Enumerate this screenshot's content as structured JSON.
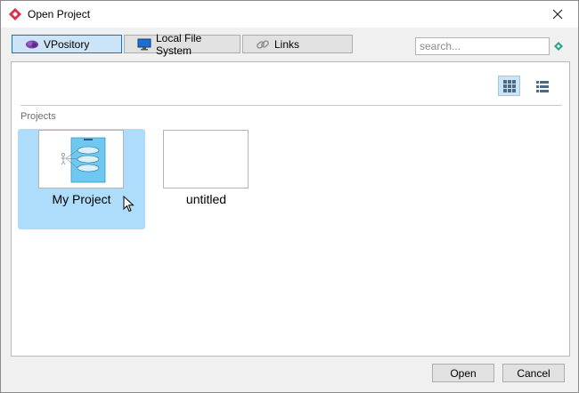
{
  "window": {
    "title": "Open Project"
  },
  "tabs": [
    {
      "label": "VPository",
      "icon": "vpository-icon",
      "active": true
    },
    {
      "label": "Local File System",
      "icon": "monitor-icon",
      "active": false
    },
    {
      "label": "Links",
      "icon": "link-icon",
      "active": false
    }
  ],
  "search": {
    "placeholder": "search...",
    "value": ""
  },
  "view": {
    "modes": [
      "grid-view-icon",
      "list-view-icon"
    ],
    "active": "grid-view-icon"
  },
  "section": {
    "label": "Projects"
  },
  "projects": [
    {
      "name": "My Project",
      "selected": true
    },
    {
      "name": "untitled",
      "selected": false
    }
  ],
  "buttons": {
    "open": "Open",
    "cancel": "Cancel"
  },
  "colors": {
    "selection": "#aedcfb",
    "active_tab": "#cce4f7",
    "brand_red": "#d9324a"
  }
}
